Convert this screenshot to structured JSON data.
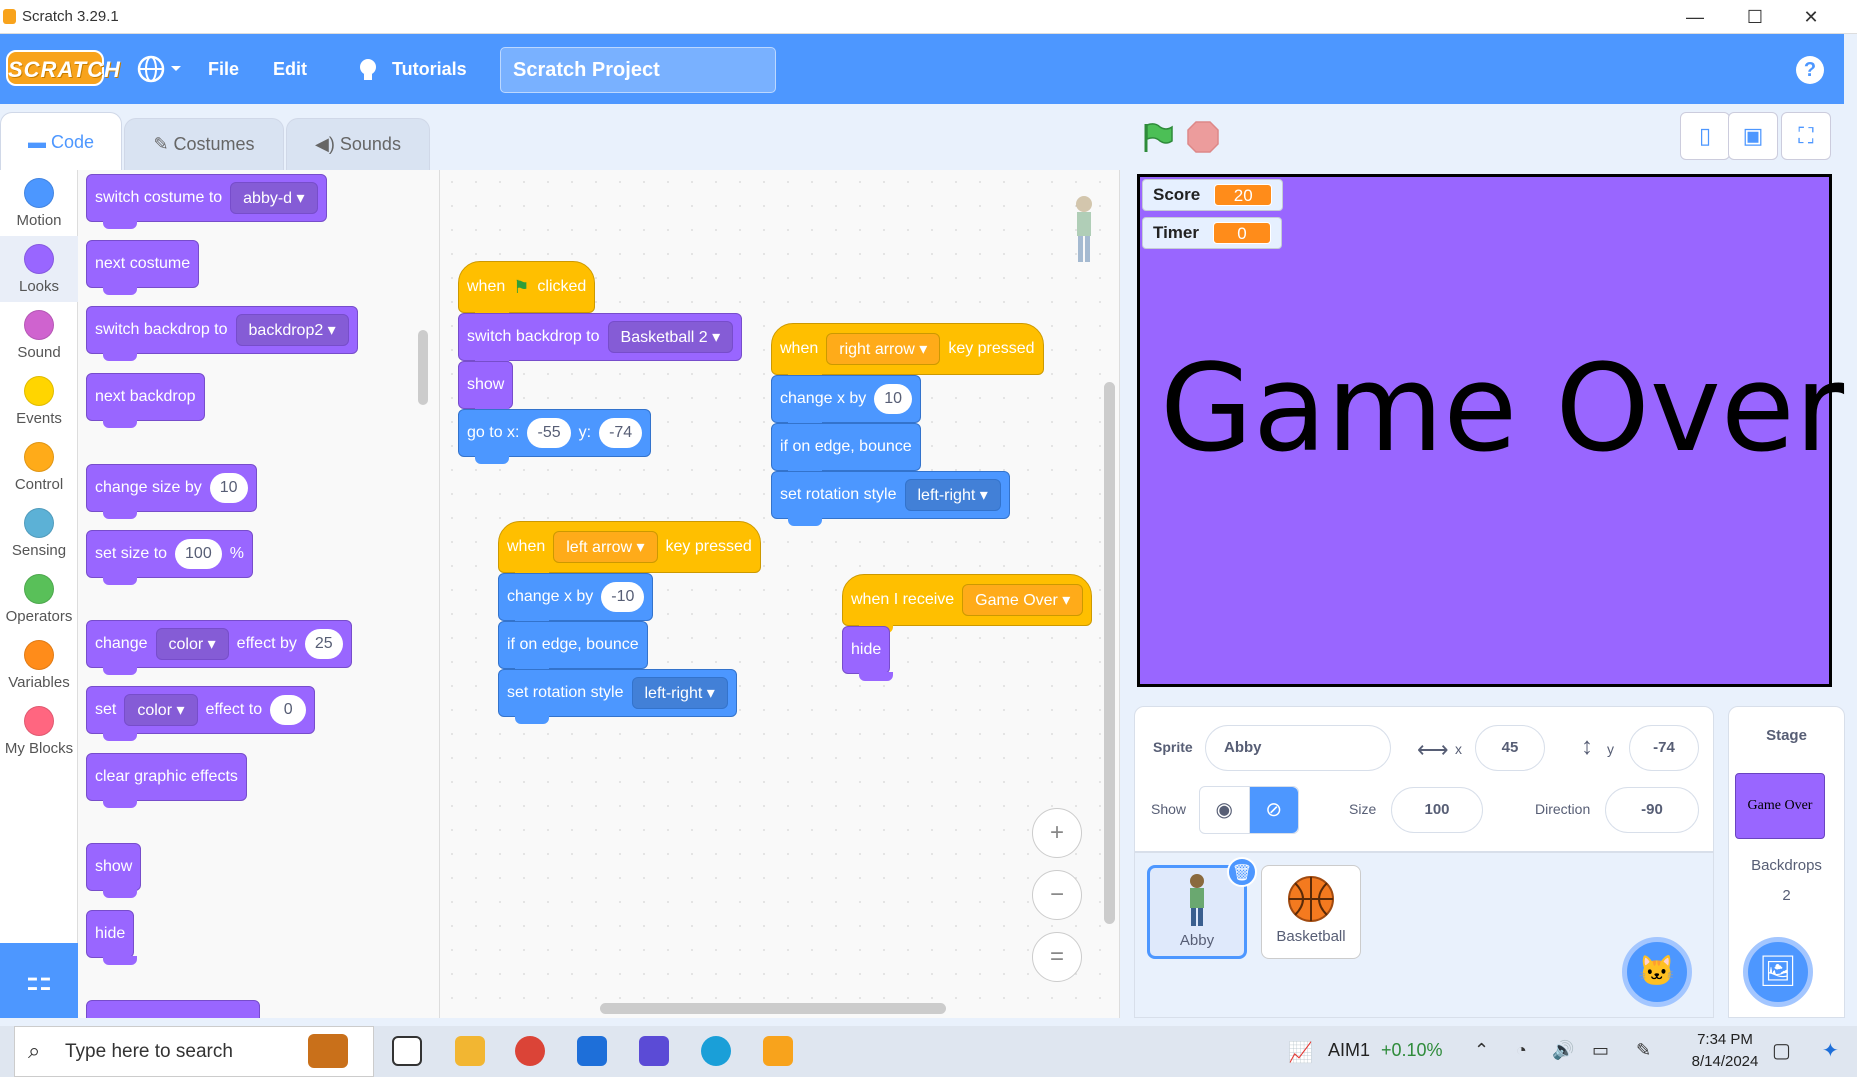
{
  "window": {
    "title": "Scratch 3.29.1",
    "minimize": "—",
    "maximize": "☐",
    "close": "✕"
  },
  "menubar": {
    "logo": "SCRATCH",
    "file": "File",
    "edit": "Edit",
    "tutorials": "Tutorials",
    "project_title": "Scratch Project",
    "help": "?"
  },
  "tabs": {
    "code": "Code",
    "costumes": "Costumes",
    "sounds": "Sounds"
  },
  "categories": [
    {
      "label": "Motion",
      "color": "#4c97ff"
    },
    {
      "label": "Looks",
      "color": "#9966ff"
    },
    {
      "label": "Sound",
      "color": "#cf63cf"
    },
    {
      "label": "Events",
      "color": "#ffd500"
    },
    {
      "label": "Control",
      "color": "#ffab19"
    },
    {
      "label": "Sensing",
      "color": "#5cb1d6"
    },
    {
      "label": "Operators",
      "color": "#59c059"
    },
    {
      "label": "Variables",
      "color": "#ff8c1a"
    },
    {
      "label": "My Blocks",
      "color": "#ff6680"
    }
  ],
  "palette": {
    "switch_costume": "switch costume to",
    "costume_val": "abby-d",
    "next_costume": "next costume",
    "switch_backdrop": "switch backdrop to",
    "backdrop_val": "backdrop2",
    "next_backdrop": "next backdrop",
    "change_size": "change size by",
    "change_size_val": "10",
    "set_size": "set size to",
    "set_size_val": "100",
    "percent": "%",
    "change_effect": "change",
    "effect_color": "color",
    "effect_by": "effect by",
    "effect_by_val": "25",
    "set_effect": "set",
    "effect_to": "effect to",
    "effect_to_val": "0",
    "clear_effects": "clear graphic effects",
    "show": "show",
    "hide": "hide"
  },
  "scripts": {
    "s1": {
      "when": "when",
      "clicked": "clicked",
      "switch_backdrop": "switch backdrop to",
      "backdrop": "Basketball 2",
      "show": "show",
      "goto_x": "go to x:",
      "x": "-55",
      "y_lbl": "y:",
      "y": "-74"
    },
    "s2": {
      "when": "when",
      "key": "right arrow",
      "key_pressed": "key pressed",
      "change_x": "change x by",
      "dx": "10",
      "bounce": "if on edge, bounce",
      "rot": "set rotation style",
      "rot_val": "left-right"
    },
    "s3": {
      "when": "when",
      "key": "left arrow",
      "key_pressed": "key pressed",
      "change_x": "change x by",
      "dx": "-10",
      "bounce": "if on edge, bounce",
      "rot": "set rotation style",
      "rot_val": "left-right"
    },
    "s4": {
      "when_receive": "when I receive",
      "msg": "Game Over",
      "hide": "hide"
    }
  },
  "zoom": {
    "in": "+",
    "out": "−",
    "reset": "="
  },
  "stage": {
    "background_color": "#9966ff",
    "monitors": [
      {
        "label": "Score",
        "value": "20"
      },
      {
        "label": "Timer",
        "value": "0"
      }
    ],
    "text": "Game Over"
  },
  "sprite_info": {
    "sprite_label": "Sprite",
    "sprite_name": "Abby",
    "x_label": "x",
    "x": "45",
    "y_label": "y",
    "y": "-74",
    "show_label": "Show",
    "size_label": "Size",
    "size": "100",
    "direction_label": "Direction",
    "direction": "-90"
  },
  "sprites": [
    {
      "name": "Abby",
      "selected": true
    },
    {
      "name": "Basketball",
      "selected": false
    }
  ],
  "stage_panel": {
    "title": "Stage",
    "thumb_text": "Game Over",
    "backdrops_label": "Backdrops",
    "backdrops_count": "2"
  },
  "taskbar": {
    "search": "Type here to search",
    "ticker": "AIM1",
    "ticker_change": "+0.10%",
    "time": "7:34 PM",
    "date": "8/14/2024"
  }
}
